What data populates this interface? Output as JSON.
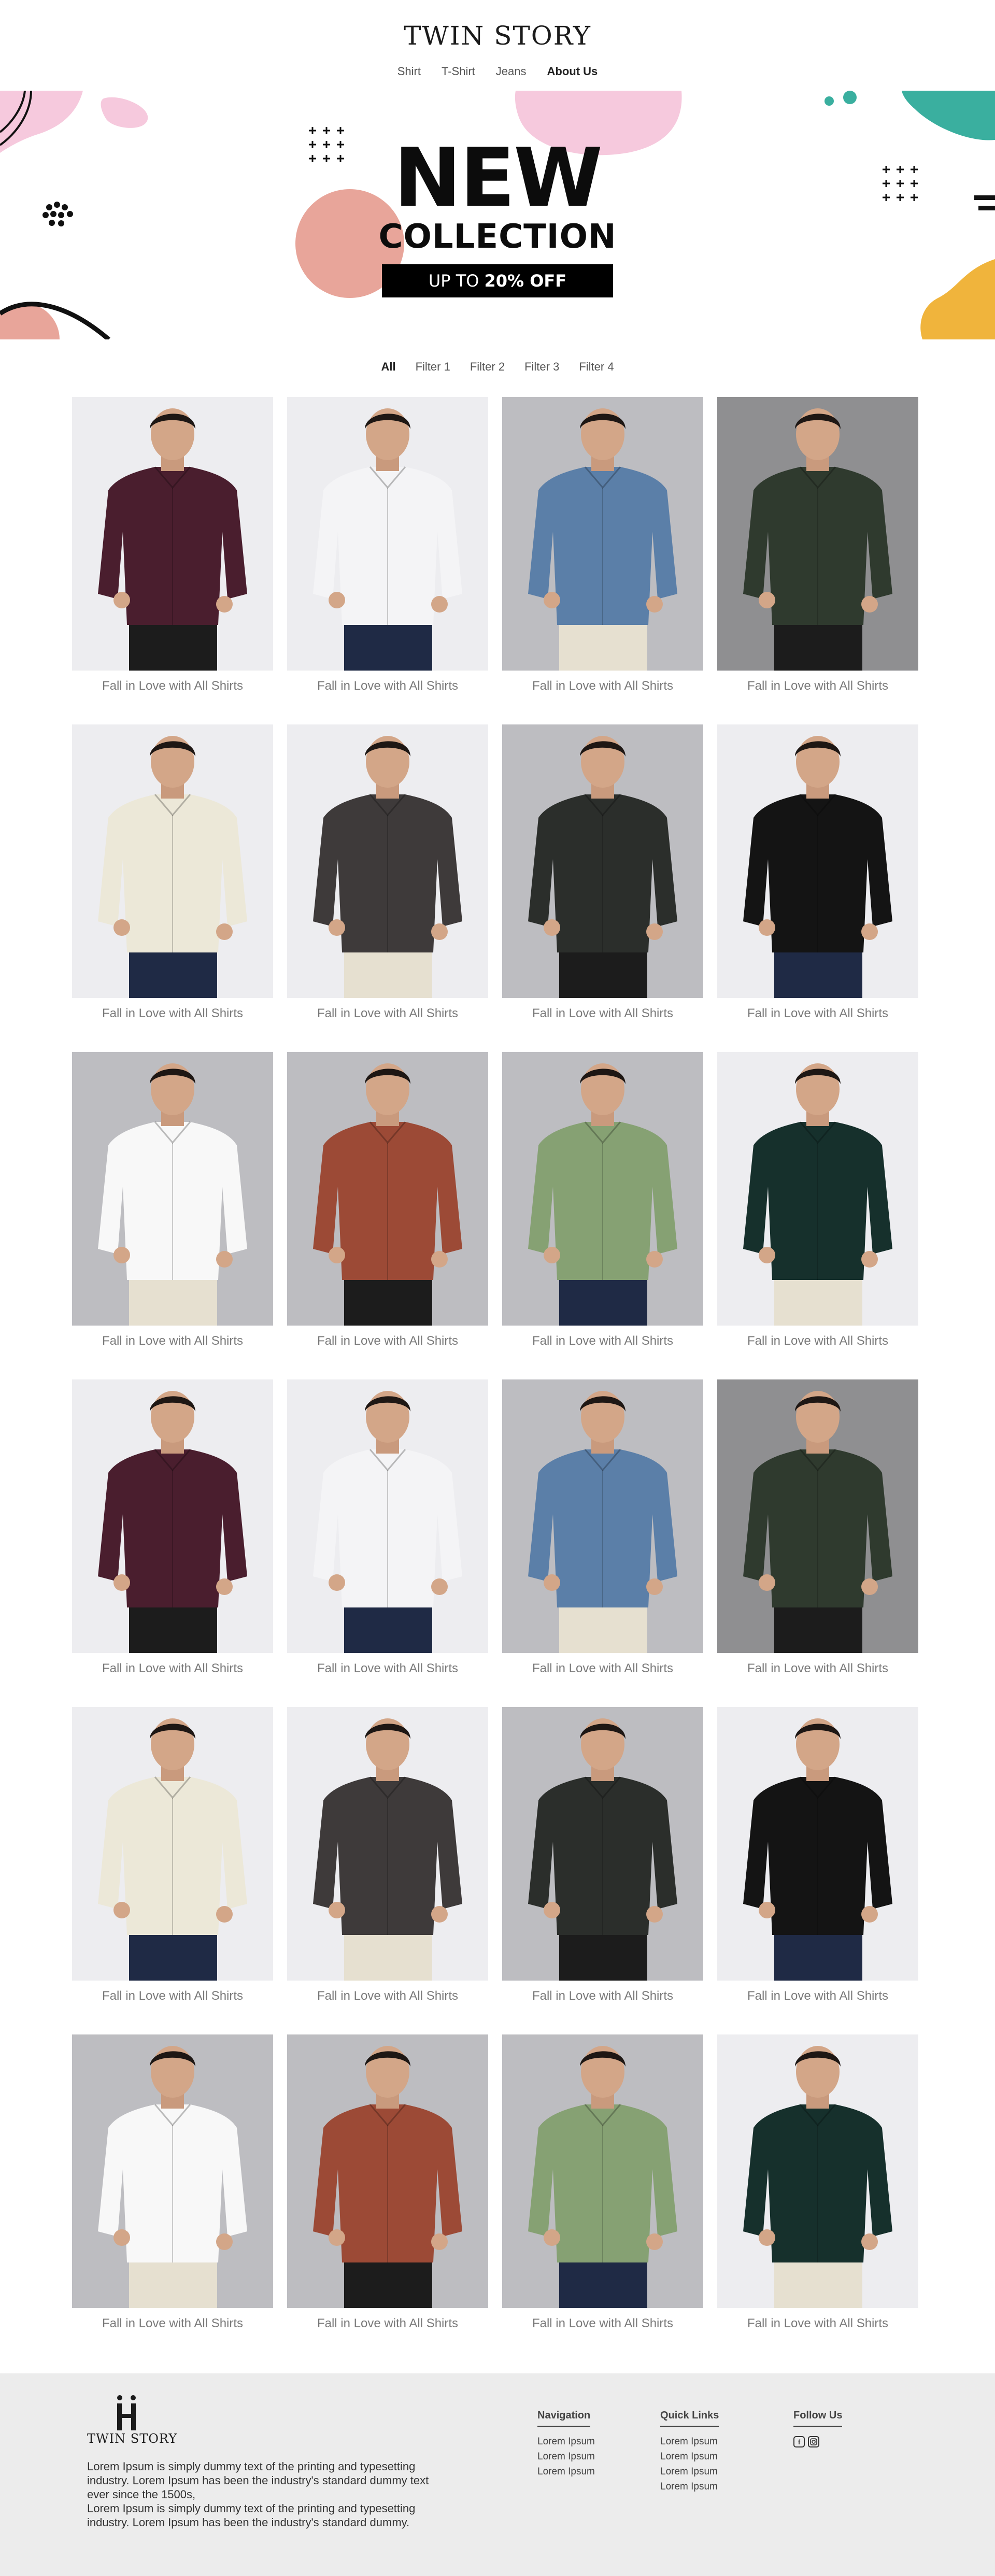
{
  "brand": {
    "name": "TWIN STORY"
  },
  "nav": [
    {
      "label": "Shirt",
      "active": false
    },
    {
      "label": "T-Shirt",
      "active": false
    },
    {
      "label": "Jeans",
      "active": false
    },
    {
      "label": "About Us",
      "active": true
    }
  ],
  "banner": {
    "title": "NEW",
    "subtitle": "COLLECTION",
    "offer_prefix": "UP TO",
    "offer_value": "20% OFF"
  },
  "filters": [
    {
      "label": "All",
      "active": true
    },
    {
      "label": "Filter 1",
      "active": false
    },
    {
      "label": "Filter 2",
      "active": false
    },
    {
      "label": "Filter 3",
      "active": false
    },
    {
      "label": "Filter 4",
      "active": false
    }
  ],
  "products": [
    {
      "caption": "Fall in Love with All Shirts",
      "shirt": "plum",
      "bg": "light"
    },
    {
      "caption": "Fall in Love with All Shirts",
      "shirt": "white-stripe",
      "bg": "light"
    },
    {
      "caption": "Fall in Love with All Shirts",
      "shirt": "blue-check",
      "bg": "grey"
    },
    {
      "caption": "Fall in Love with All Shirts",
      "shirt": "olive-dark",
      "bg": "dark"
    },
    {
      "caption": "Fall in Love with All Shirts",
      "shirt": "cream-print",
      "bg": "light"
    },
    {
      "caption": "Fall in Love with All Shirts",
      "shirt": "brown-check",
      "bg": "light"
    },
    {
      "caption": "Fall in Love with All Shirts",
      "shirt": "black-check",
      "bg": "grey"
    },
    {
      "caption": "Fall in Love with All Shirts",
      "shirt": "black",
      "bg": "light"
    },
    {
      "caption": "Fall in Love with All Shirts",
      "shirt": "white",
      "bg": "grey"
    },
    {
      "caption": "Fall in Love with All Shirts",
      "shirt": "red-check",
      "bg": "grey"
    },
    {
      "caption": "Fall in Love with All Shirts",
      "shirt": "sage",
      "bg": "grey"
    },
    {
      "caption": "Fall in Love with All Shirts",
      "shirt": "green-stripe",
      "bg": "light"
    },
    {
      "caption": "Fall in Love with All Shirts",
      "shirt": "plum",
      "bg": "light"
    },
    {
      "caption": "Fall in Love with All Shirts",
      "shirt": "white-stripe",
      "bg": "light"
    },
    {
      "caption": "Fall in Love with All Shirts",
      "shirt": "blue-check",
      "bg": "grey"
    },
    {
      "caption": "Fall in Love with All Shirts",
      "shirt": "olive-dark",
      "bg": "dark"
    },
    {
      "caption": "Fall in Love with All Shirts",
      "shirt": "cream-print",
      "bg": "light"
    },
    {
      "caption": "Fall in Love with All Shirts",
      "shirt": "brown-check",
      "bg": "light"
    },
    {
      "caption": "Fall in Love with All Shirts",
      "shirt": "black-check",
      "bg": "grey"
    },
    {
      "caption": "Fall in Love with All Shirts",
      "shirt": "black",
      "bg": "light"
    },
    {
      "caption": "Fall in Love with All Shirts",
      "shirt": "white",
      "bg": "grey"
    },
    {
      "caption": "Fall in Love with All Shirts",
      "shirt": "red-check",
      "bg": "grey"
    },
    {
      "caption": "Fall in Love with All Shirts",
      "shirt": "sage",
      "bg": "grey"
    },
    {
      "caption": "Fall in Love with All Shirts",
      "shirt": "green-stripe",
      "bg": "light"
    }
  ],
  "footer": {
    "brand": "TWIN STORY",
    "about": [
      "Lorem Ipsum is simply dummy text of the printing and typesetting industry. Lorem Ipsum has been the industry's standard dummy text ever since the 1500s,",
      "Lorem Ipsum is simply dummy text of the printing and typesetting industry. Lorem Ipsum has been the industry's standard dummy."
    ],
    "navigation": {
      "title": "Navigation",
      "items": [
        "Lorem Ipsum",
        "Lorem Ipsum",
        "Lorem Ipsum"
      ]
    },
    "quick_links": {
      "title": "Quick Links",
      "items": [
        "Lorem Ipsum",
        "Lorem Ipsum",
        "Lorem Ipsum",
        "Lorem Ipsum"
      ]
    },
    "follow": {
      "title": "Follow Us",
      "icons": [
        "facebook-icon",
        "instagram-icon"
      ]
    }
  },
  "colors": {
    "accent_pink": "#f6c9dd",
    "accent_salmon": "#e8a59a",
    "accent_teal": "#3aaf9f",
    "accent_yellow": "#f0b43c",
    "footer_bg": "#ececec",
    "shirts": {
      "plum": "#4a1e2e",
      "white-stripe": "#f4f4f6",
      "blue-check": "#5b7fa8",
      "olive-dark": "#2f3a2e",
      "cream-print": "#ece8d8",
      "brown-check": "#3e3a3a",
      "black-check": "#2b2e2b",
      "black": "#141414",
      "white": "#f8f8f8",
      "red-check": "#9c4a36",
      "sage": "#86a173",
      "green-stripe": "#16302c"
    }
  }
}
